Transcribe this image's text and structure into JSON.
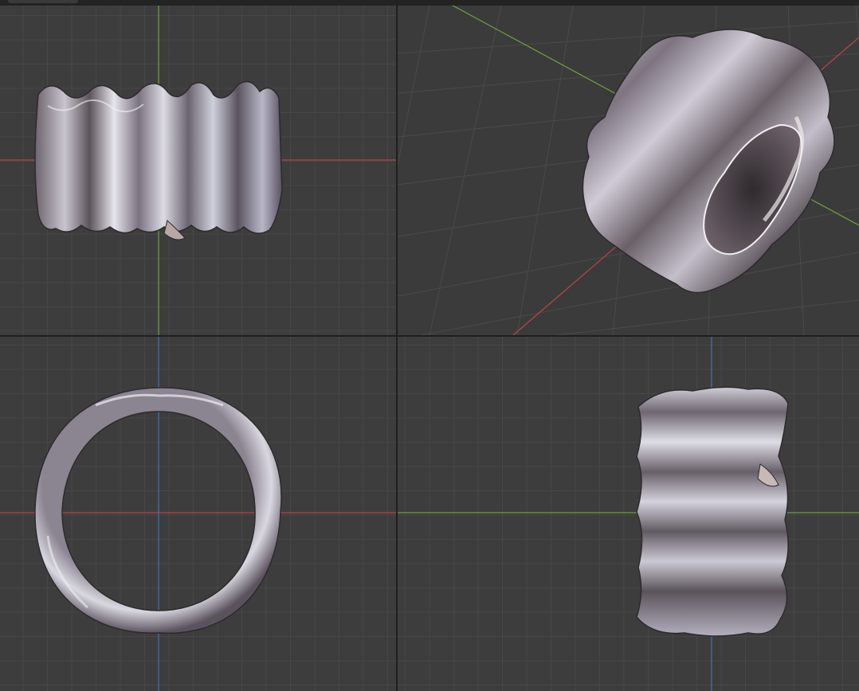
{
  "app": {
    "layout": "quad-view",
    "colors": {
      "background": "#3d3d3d",
      "grid": "#474747",
      "axis_x": "#b8434a",
      "axis_y": "#6e9a3a",
      "axis_z": "#3d72b0",
      "mesh_light": "#dcdde6",
      "mesh_mid": "#8f8998",
      "mesh_dark": "#3a3236"
    }
  },
  "viewports": [
    {
      "id": "front",
      "object": "wavy-ring-mesh",
      "axes": [
        "x",
        "z"
      ]
    },
    {
      "id": "perspective",
      "object": "wavy-ring-mesh",
      "axes": [
        "x",
        "y"
      ]
    },
    {
      "id": "top",
      "object": "wavy-ring-mesh",
      "axes": [
        "x",
        "z"
      ]
    },
    {
      "id": "side",
      "object": "wavy-ring-mesh",
      "axes": [
        "y",
        "z"
      ]
    }
  ]
}
